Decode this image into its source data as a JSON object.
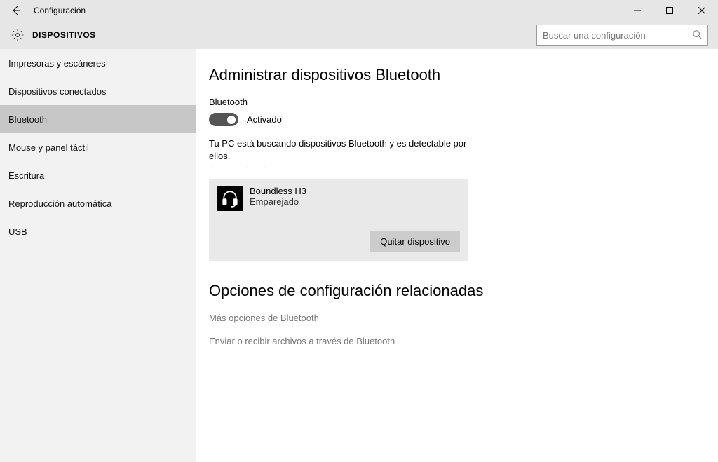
{
  "window": {
    "title": "Configuración"
  },
  "header": {
    "title": "DISPOSITIVOS",
    "search_placeholder": "Buscar una configuración"
  },
  "sidebar": {
    "items": [
      {
        "label": "Impresoras y escáneres"
      },
      {
        "label": "Dispositivos conectados"
      },
      {
        "label": "Bluetooth",
        "selected": true
      },
      {
        "label": "Mouse y panel táctil"
      },
      {
        "label": "Escritura"
      },
      {
        "label": "Reproducción automática"
      },
      {
        "label": "USB"
      }
    ]
  },
  "main": {
    "title": "Administrar dispositivos Bluetooth",
    "toggle_label": "Bluetooth",
    "toggle_state": "Activado",
    "status_text": "Tu PC está buscando dispositivos Bluetooth y es detectable por ellos.",
    "device": {
      "name": "Boundless H3",
      "status": "Emparejado",
      "remove_label": "Quitar dispositivo"
    },
    "related_title": "Opciones de configuración relacionadas",
    "links": [
      "Más opciones de Bluetooth",
      "Enviar o recibir archivos a través de Bluetooth"
    ]
  }
}
